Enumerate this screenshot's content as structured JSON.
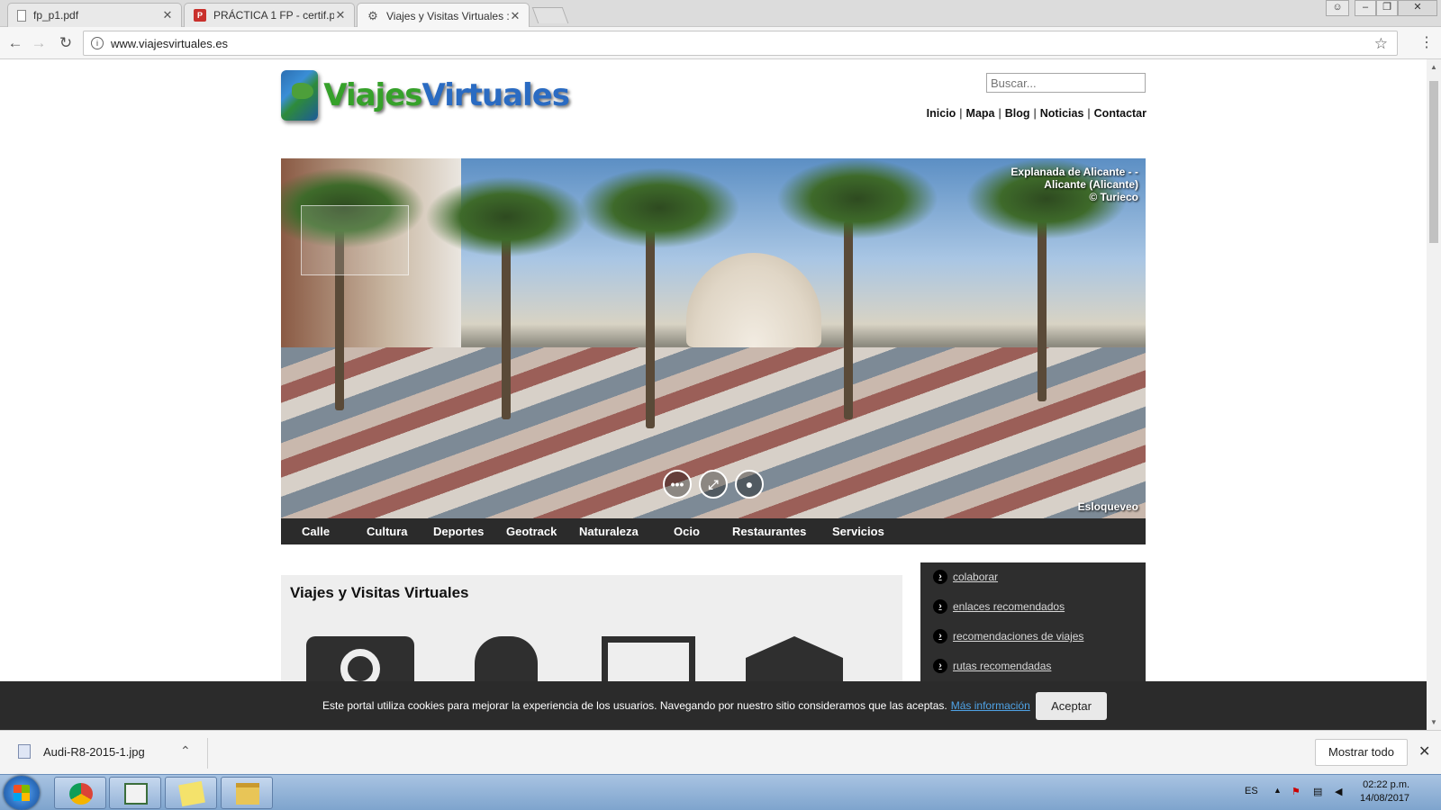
{
  "browser": {
    "tabs": [
      {
        "label": "fp_p1.pdf",
        "icon": "document-icon"
      },
      {
        "label": "PRÁCTICA 1 FP - certif.pc",
        "icon": "pdf-icon"
      },
      {
        "label": "Viajes y Visitas Virtuales :",
        "icon": "gear-icon"
      }
    ],
    "url": "www.viajesvirtuales.es"
  },
  "site": {
    "logo_part1": "Viajes",
    "logo_part2": "Virtuales",
    "search_placeholder": "Buscar...",
    "topnav": [
      "Inicio",
      "Mapa",
      "Blog",
      "Noticias",
      "Contactar"
    ],
    "pano_caption": [
      "Explanada de Alicante - -",
      "Alicante (Alicante)",
      "© Turieco"
    ],
    "pano_credit": "Esloqueveo",
    "categories": [
      "Calle",
      "Cultura",
      "Deportes",
      "Geotrack",
      "Naturaleza",
      "Ocio",
      "Restaurantes",
      "Servicios"
    ],
    "main_title": "Viajes y Visitas Virtuales",
    "sidebar_links": [
      "colaborar",
      "enlaces recomendados",
      "recomendaciones de viajes",
      "rutas recomendadas"
    ],
    "cookie_message": "Este portal utiliza cookies para mejorar la experiencia de los usuarios. Navegando por nuestro sitio consideramos que las aceptas.",
    "cookie_more": "Más información",
    "cookie_accept": "Aceptar"
  },
  "downloads": {
    "file": "Audi-R8-2015-1.jpg",
    "show_all": "Mostrar todo"
  },
  "taskbar": {
    "lang": "ES",
    "time": "02:22 p.m.",
    "date": "14/08/2017"
  },
  "colors": {
    "accent_link": "#4fa3e6",
    "logo_green": "#36a12a",
    "logo_blue": "#2a6bc2",
    "dark_bar": "#2b2b2b"
  }
}
